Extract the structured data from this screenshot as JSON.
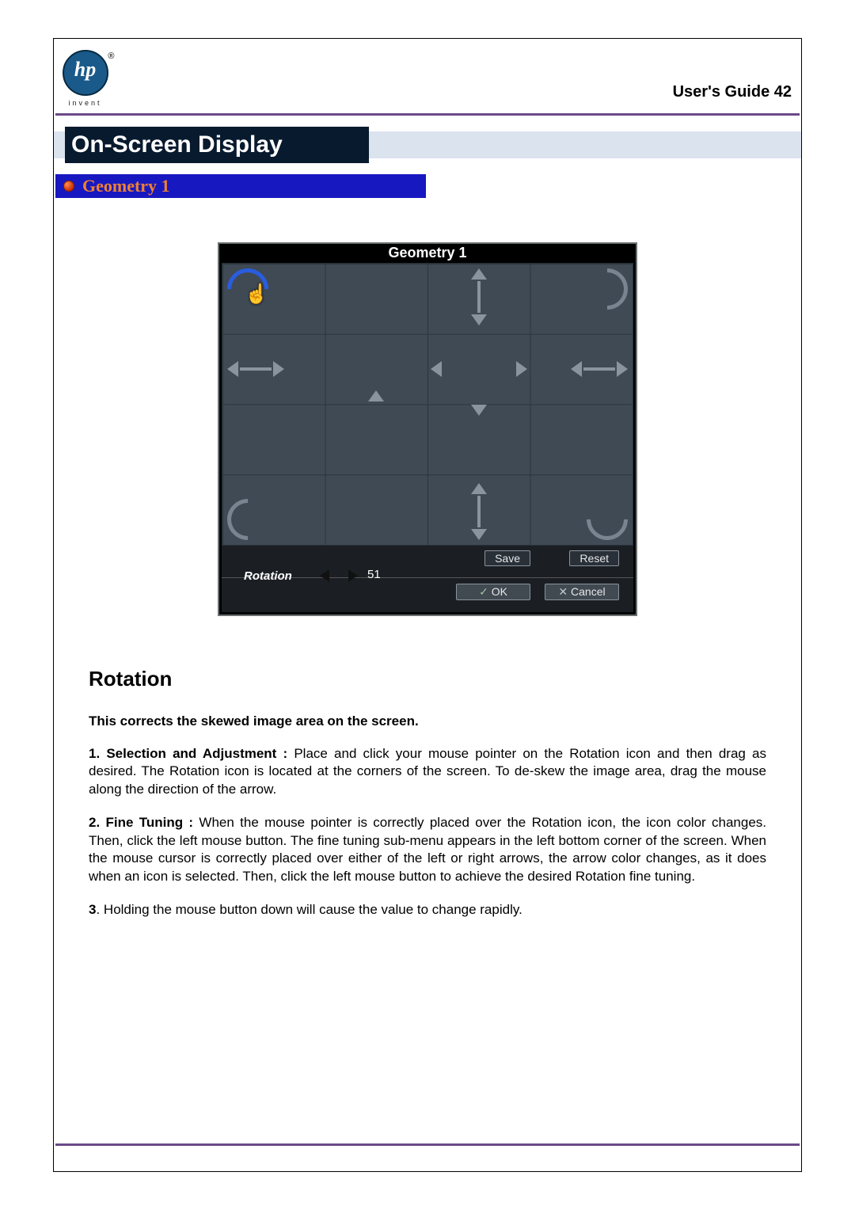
{
  "header": {
    "brand_text": "hp",
    "brand_tag": "invent",
    "registered": "®",
    "guide_label": "User's Guide",
    "page_number": "42"
  },
  "title_band": "On-Screen Display",
  "section_bar": "Geometry 1",
  "osd": {
    "title": "Geometry 1",
    "rotation_label": "Rotation",
    "rotation_value": "51",
    "btn_save": "Save",
    "btn_reset": "Reset",
    "btn_ok": "OK",
    "btn_cancel": "Cancel"
  },
  "body": {
    "heading": "Rotation",
    "intro_bold": "This corrects the skewed image area on the screen.",
    "p1_lead": "1. Selection and Adjustment : ",
    "p1_rest": "Place and click your mouse pointer on the Rotation icon and then drag as desired. The Rotation icon is located at the corners of the screen. To de-skew the image area, drag the mouse along the direction of the arrow.",
    "p2_lead": "2. Fine Tuning : ",
    "p2_rest": "When the mouse pointer is correctly placed over the Rotation icon, the icon color changes. Then, click the left mouse button. The fine tuning sub-menu appears in the left bottom corner of the screen. When the mouse cursor is correctly placed over either of the left or right arrows, the arrow color changes, as it does when an icon is selected. Then, click the left mouse button to achieve the desired Rotation fine tuning.",
    "p3_lead": "3",
    "p3_rest": ". Holding the mouse button down will cause the value to change rapidly."
  }
}
